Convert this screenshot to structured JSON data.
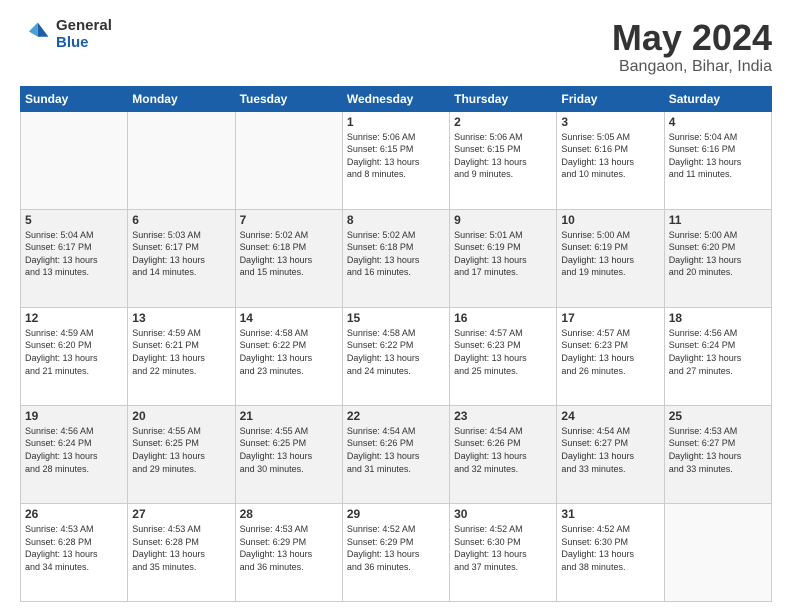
{
  "logo": {
    "general": "General",
    "blue": "Blue"
  },
  "title": "May 2024",
  "location": "Bangaon, Bihar, India",
  "days_header": [
    "Sunday",
    "Monday",
    "Tuesday",
    "Wednesday",
    "Thursday",
    "Friday",
    "Saturday"
  ],
  "weeks": [
    {
      "shaded": false,
      "days": [
        {
          "num": "",
          "info": ""
        },
        {
          "num": "",
          "info": ""
        },
        {
          "num": "",
          "info": ""
        },
        {
          "num": "1",
          "info": "Sunrise: 5:06 AM\nSunset: 6:15 PM\nDaylight: 13 hours\nand 8 minutes."
        },
        {
          "num": "2",
          "info": "Sunrise: 5:06 AM\nSunset: 6:15 PM\nDaylight: 13 hours\nand 9 minutes."
        },
        {
          "num": "3",
          "info": "Sunrise: 5:05 AM\nSunset: 6:16 PM\nDaylight: 13 hours\nand 10 minutes."
        },
        {
          "num": "4",
          "info": "Sunrise: 5:04 AM\nSunset: 6:16 PM\nDaylight: 13 hours\nand 11 minutes."
        }
      ]
    },
    {
      "shaded": true,
      "days": [
        {
          "num": "5",
          "info": "Sunrise: 5:04 AM\nSunset: 6:17 PM\nDaylight: 13 hours\nand 13 minutes."
        },
        {
          "num": "6",
          "info": "Sunrise: 5:03 AM\nSunset: 6:17 PM\nDaylight: 13 hours\nand 14 minutes."
        },
        {
          "num": "7",
          "info": "Sunrise: 5:02 AM\nSunset: 6:18 PM\nDaylight: 13 hours\nand 15 minutes."
        },
        {
          "num": "8",
          "info": "Sunrise: 5:02 AM\nSunset: 6:18 PM\nDaylight: 13 hours\nand 16 minutes."
        },
        {
          "num": "9",
          "info": "Sunrise: 5:01 AM\nSunset: 6:19 PM\nDaylight: 13 hours\nand 17 minutes."
        },
        {
          "num": "10",
          "info": "Sunrise: 5:00 AM\nSunset: 6:19 PM\nDaylight: 13 hours\nand 19 minutes."
        },
        {
          "num": "11",
          "info": "Sunrise: 5:00 AM\nSunset: 6:20 PM\nDaylight: 13 hours\nand 20 minutes."
        }
      ]
    },
    {
      "shaded": false,
      "days": [
        {
          "num": "12",
          "info": "Sunrise: 4:59 AM\nSunset: 6:20 PM\nDaylight: 13 hours\nand 21 minutes."
        },
        {
          "num": "13",
          "info": "Sunrise: 4:59 AM\nSunset: 6:21 PM\nDaylight: 13 hours\nand 22 minutes."
        },
        {
          "num": "14",
          "info": "Sunrise: 4:58 AM\nSunset: 6:22 PM\nDaylight: 13 hours\nand 23 minutes."
        },
        {
          "num": "15",
          "info": "Sunrise: 4:58 AM\nSunset: 6:22 PM\nDaylight: 13 hours\nand 24 minutes."
        },
        {
          "num": "16",
          "info": "Sunrise: 4:57 AM\nSunset: 6:23 PM\nDaylight: 13 hours\nand 25 minutes."
        },
        {
          "num": "17",
          "info": "Sunrise: 4:57 AM\nSunset: 6:23 PM\nDaylight: 13 hours\nand 26 minutes."
        },
        {
          "num": "18",
          "info": "Sunrise: 4:56 AM\nSunset: 6:24 PM\nDaylight: 13 hours\nand 27 minutes."
        }
      ]
    },
    {
      "shaded": true,
      "days": [
        {
          "num": "19",
          "info": "Sunrise: 4:56 AM\nSunset: 6:24 PM\nDaylight: 13 hours\nand 28 minutes."
        },
        {
          "num": "20",
          "info": "Sunrise: 4:55 AM\nSunset: 6:25 PM\nDaylight: 13 hours\nand 29 minutes."
        },
        {
          "num": "21",
          "info": "Sunrise: 4:55 AM\nSunset: 6:25 PM\nDaylight: 13 hours\nand 30 minutes."
        },
        {
          "num": "22",
          "info": "Sunrise: 4:54 AM\nSunset: 6:26 PM\nDaylight: 13 hours\nand 31 minutes."
        },
        {
          "num": "23",
          "info": "Sunrise: 4:54 AM\nSunset: 6:26 PM\nDaylight: 13 hours\nand 32 minutes."
        },
        {
          "num": "24",
          "info": "Sunrise: 4:54 AM\nSunset: 6:27 PM\nDaylight: 13 hours\nand 33 minutes."
        },
        {
          "num": "25",
          "info": "Sunrise: 4:53 AM\nSunset: 6:27 PM\nDaylight: 13 hours\nand 33 minutes."
        }
      ]
    },
    {
      "shaded": false,
      "days": [
        {
          "num": "26",
          "info": "Sunrise: 4:53 AM\nSunset: 6:28 PM\nDaylight: 13 hours\nand 34 minutes."
        },
        {
          "num": "27",
          "info": "Sunrise: 4:53 AM\nSunset: 6:28 PM\nDaylight: 13 hours\nand 35 minutes."
        },
        {
          "num": "28",
          "info": "Sunrise: 4:53 AM\nSunset: 6:29 PM\nDaylight: 13 hours\nand 36 minutes."
        },
        {
          "num": "29",
          "info": "Sunrise: 4:52 AM\nSunset: 6:29 PM\nDaylight: 13 hours\nand 36 minutes."
        },
        {
          "num": "30",
          "info": "Sunrise: 4:52 AM\nSunset: 6:30 PM\nDaylight: 13 hours\nand 37 minutes."
        },
        {
          "num": "31",
          "info": "Sunrise: 4:52 AM\nSunset: 6:30 PM\nDaylight: 13 hours\nand 38 minutes."
        },
        {
          "num": "",
          "info": ""
        }
      ]
    }
  ]
}
